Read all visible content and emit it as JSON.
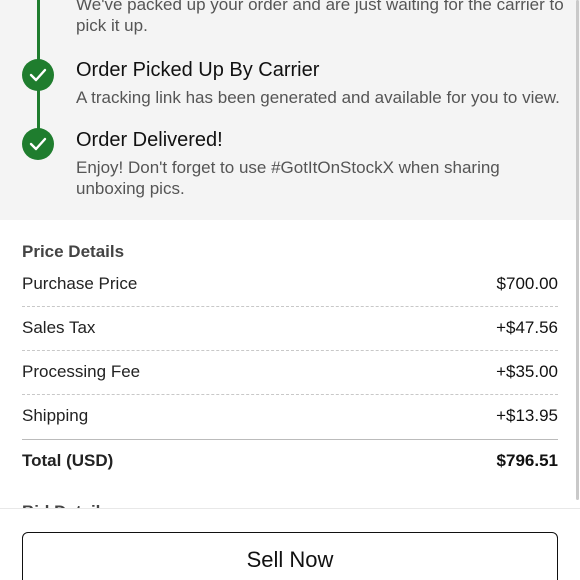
{
  "timeline": {
    "steps": [
      {
        "title": "",
        "description_line1": "We've packed up your order and are just waiting for the carrier to",
        "description_line2": "pick it up."
      },
      {
        "title": "Order Picked Up By Carrier",
        "description": "A tracking link has been generated and available for you to view."
      },
      {
        "title": "Order Delivered!",
        "description_line1": "Enjoy! Don't forget to use #GotItOnStockX when sharing",
        "description_line2": "unboxing pics."
      }
    ],
    "check_icon": "check-icon",
    "accent_color": "#1f7d2e"
  },
  "price_details": {
    "title": "Price Details",
    "rows": [
      {
        "label": "Purchase Price",
        "value": "$700.00"
      },
      {
        "label": "Sales Tax",
        "value": "+$47.56"
      },
      {
        "label": "Processing Fee",
        "value": "+$35.00"
      },
      {
        "label": "Shipping",
        "value": "+$13.95"
      }
    ],
    "total": {
      "label": "Total (USD)",
      "value": "$796.51"
    }
  },
  "next_section": {
    "title": "Bid Details"
  },
  "action": {
    "sell_label": "Sell Now"
  }
}
